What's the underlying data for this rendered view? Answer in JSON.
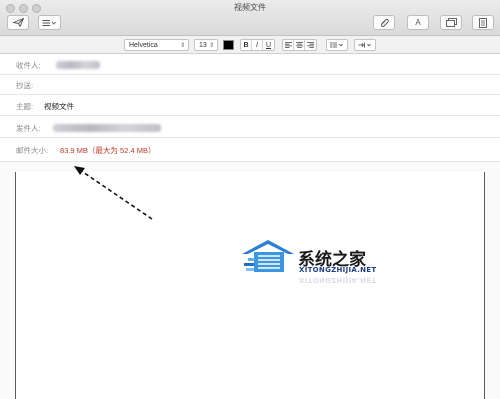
{
  "window": {
    "title": "视频文件"
  },
  "toolbar": {
    "send_icon": "paper-plane-icon",
    "header_fields_icon": "list-icon",
    "attach_icon": "paperclip-icon",
    "font_icon": "font-icon",
    "font_label": "A",
    "photo_icon": "photo-browser-icon",
    "stationery_icon": "stationery-icon"
  },
  "format": {
    "font_family": "Helvetica",
    "font_size": "13",
    "text_color": "#000000",
    "bold_label": "B",
    "italic_label": "I",
    "underline_label": "U"
  },
  "fields": {
    "to_label": "收件人:",
    "cc_label": "抄送:",
    "subject_label": "主题:",
    "subject_value": "视频文件",
    "from_label": "发件人:",
    "size_label": "邮件大小:",
    "size_value": "83.9 MB（最大为 52.4 MB）"
  },
  "watermark": {
    "name": "系统之家",
    "site": "XITONGZHIJIA.NET"
  }
}
